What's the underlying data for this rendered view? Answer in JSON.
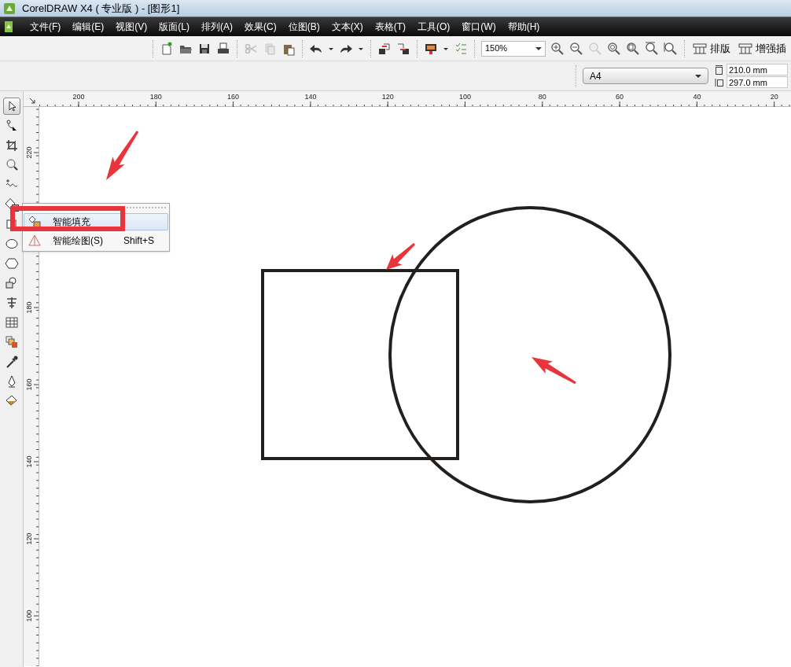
{
  "window": {
    "title": "CorelDRAW X4 ( 专业版 ) - [图形1]"
  },
  "menu_bar": [
    "文件(F)",
    "编辑(E)",
    "视图(V)",
    "版面(L)",
    "排列(A)",
    "效果(C)",
    "位图(B)",
    "文本(X)",
    "表格(T)",
    "工具(O)",
    "窗口(W)",
    "帮助(H)"
  ],
  "standard_toolbar": {
    "zoom_level": "150%",
    "buttons": [
      "排版",
      "增强插"
    ]
  },
  "property_bar": {
    "page_size": "A4",
    "width": "210.0 mm",
    "height": "297.0 mm"
  },
  "toolbox": {
    "tools": [
      {
        "selected": true
      },
      {
        "selected": false
      },
      {
        "selected": false
      },
      {
        "selected": false
      },
      {
        "selected": false
      },
      {
        "selected": false
      },
      {
        "selected": false
      },
      {
        "selected": false
      },
      {
        "selected": false
      },
      {
        "selected": false
      },
      {
        "selected": false
      },
      {
        "selected": false
      },
      {
        "selected": false
      },
      {
        "selected": false
      },
      {
        "selected": false
      },
      {
        "selected": false
      }
    ]
  },
  "flyout_menu": {
    "items": [
      {
        "label": "智能填充",
        "selected": true
      },
      {
        "label": "智能绘图(S)",
        "shortcut": "Shift+S",
        "selected": false
      }
    ]
  },
  "horizontal_ruler": [
    "200",
    "180",
    "160",
    "140",
    "120",
    "100",
    "80",
    "60",
    "40",
    "20"
  ],
  "vertical_ruler": [
    "220",
    "180",
    "160",
    "140",
    "120",
    "100"
  ]
}
